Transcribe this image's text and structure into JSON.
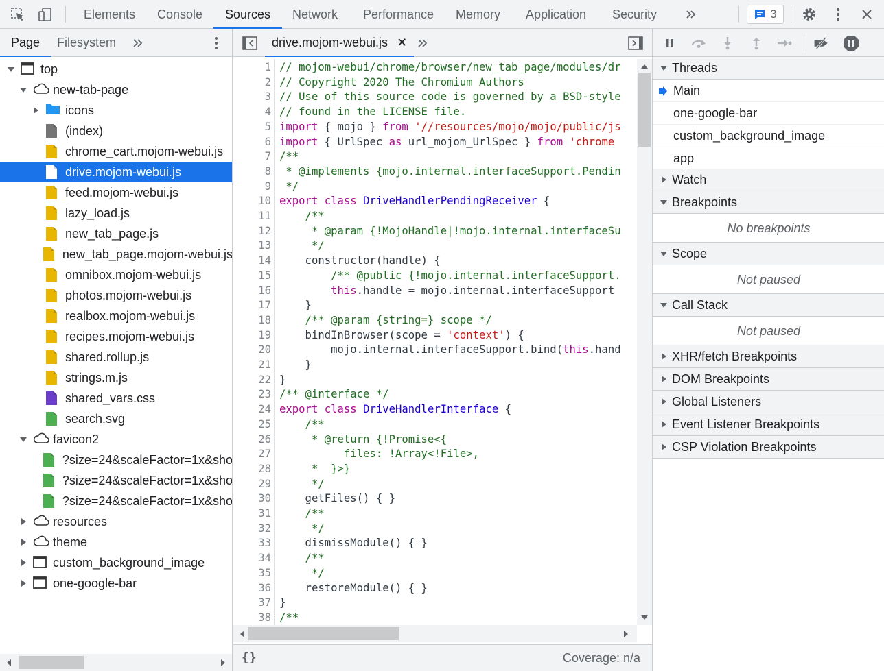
{
  "toolbar": {
    "tabs": [
      "Elements",
      "Console",
      "Sources",
      "Network",
      "Performance",
      "Memory",
      "Application",
      "Security"
    ],
    "active_tab": "Sources",
    "issues_count": "3",
    "icons": [
      "inspect-element-icon",
      "device-toolbar-icon",
      "more-tabs-icon",
      "issues-icon",
      "settings-gear-icon",
      "more-options-icon",
      "close-icon"
    ]
  },
  "navigator": {
    "tabs": [
      "Page",
      "Filesystem"
    ],
    "active_tab": "Page",
    "tree": [
      {
        "label": "top",
        "icon": "frame-icon",
        "expanded": true,
        "depth": 0
      },
      {
        "label": "new-tab-page",
        "icon": "cloud-icon",
        "expanded": true,
        "depth": 1
      },
      {
        "label": "icons",
        "icon": "folder-icon",
        "expanded": false,
        "depth": 2
      },
      {
        "label": "(index)",
        "icon": "document-icon",
        "depth": 2,
        "color": "#757575"
      },
      {
        "label": "chrome_cart.mojom-webui.js",
        "icon": "script-icon",
        "depth": 2,
        "color": "#e8b600"
      },
      {
        "label": "drive.mojom-webui.js",
        "icon": "script-icon",
        "depth": 2,
        "color": "#ffffff",
        "selected": true
      },
      {
        "label": "feed.mojom-webui.js",
        "icon": "script-icon",
        "depth": 2,
        "color": "#e8b600"
      },
      {
        "label": "lazy_load.js",
        "icon": "script-icon",
        "depth": 2,
        "color": "#e8b600"
      },
      {
        "label": "new_tab_page.js",
        "icon": "script-icon",
        "depth": 2,
        "color": "#e8b600"
      },
      {
        "label": "new_tab_page.mojom-webui.js",
        "icon": "script-icon",
        "depth": 2,
        "color": "#e8b600"
      },
      {
        "label": "omnibox.mojom-webui.js",
        "icon": "script-icon",
        "depth": 2,
        "color": "#e8b600"
      },
      {
        "label": "photos.mojom-webui.js",
        "icon": "script-icon",
        "depth": 2,
        "color": "#e8b600"
      },
      {
        "label": "realbox.mojom-webui.js",
        "icon": "script-icon",
        "depth": 2,
        "color": "#e8b600"
      },
      {
        "label": "recipes.mojom-webui.js",
        "icon": "script-icon",
        "depth": 2,
        "color": "#e8b600"
      },
      {
        "label": "shared.rollup.js",
        "icon": "script-icon",
        "depth": 2,
        "color": "#e8b600"
      },
      {
        "label": "strings.m.js",
        "icon": "script-icon",
        "depth": 2,
        "color": "#e8b600"
      },
      {
        "label": "shared_vars.css",
        "icon": "stylesheet-icon",
        "depth": 2,
        "color": "#6a3ec6"
      },
      {
        "label": "search.svg",
        "icon": "image-icon",
        "depth": 2,
        "color": "#4caf50"
      },
      {
        "label": "favicon2",
        "icon": "cloud-icon",
        "expanded": true,
        "depth": 1
      },
      {
        "label": "?size=24&scaleFactor=1x&sho",
        "icon": "image-icon",
        "depth": 2,
        "color": "#4caf50"
      },
      {
        "label": "?size=24&scaleFactor=1x&sho",
        "icon": "image-icon",
        "depth": 2,
        "color": "#4caf50"
      },
      {
        "label": "?size=24&scaleFactor=1x&sho",
        "icon": "image-icon",
        "depth": 2,
        "color": "#4caf50"
      },
      {
        "label": "resources",
        "icon": "cloud-icon",
        "expanded": false,
        "depth": 1
      },
      {
        "label": "theme",
        "icon": "cloud-icon",
        "expanded": false,
        "depth": 1
      },
      {
        "label": "custom_background_image",
        "icon": "frame-icon",
        "expanded": false,
        "depth": 1
      },
      {
        "label": "one-google-bar",
        "icon": "frame-icon",
        "expanded": false,
        "depth": 1
      }
    ]
  },
  "editor": {
    "file_tab": "drive.mojom-webui.js",
    "status": {
      "pretty_print": "{}",
      "coverage": "Coverage: n/a"
    },
    "lines": [
      [
        [
          "c",
          "// mojom-webui/chrome/browser/new_tab_page/modules/dr"
        ]
      ],
      [
        [
          "c",
          "// Copyright 2020 The Chromium Authors"
        ]
      ],
      [
        [
          "c",
          "// Use of this source code is governed by a BSD-style"
        ]
      ],
      [
        [
          "c",
          "// found in the LICENSE file."
        ]
      ],
      [
        [
          "k",
          "import"
        ],
        [
          "p",
          " { mojo } "
        ],
        [
          "k",
          "from"
        ],
        [
          "p",
          " "
        ],
        [
          "s",
          "'//resources/mojo/mojo/public/js"
        ]
      ],
      [
        [
          "k",
          "import"
        ],
        [
          "p",
          " { UrlSpec "
        ],
        [
          "k",
          "as"
        ],
        [
          "p",
          " url_mojom_UrlSpec } "
        ],
        [
          "k",
          "from"
        ],
        [
          "p",
          " "
        ],
        [
          "s",
          "'chrome"
        ]
      ],
      [
        [
          "c",
          "/**"
        ]
      ],
      [
        [
          "c",
          " * @implements {mojo.internal.interfaceSupport.Pendin"
        ]
      ],
      [
        [
          "c",
          " */"
        ]
      ],
      [
        [
          "k",
          "export class"
        ],
        [
          "p",
          " "
        ],
        [
          "t",
          "DriveHandlerPendingReceiver"
        ],
        [
          "p",
          " {"
        ]
      ],
      [
        [
          "c",
          "    /**"
        ]
      ],
      [
        [
          "c",
          "     * @param {!MojoHandle|!mojo.internal.interfaceSu"
        ]
      ],
      [
        [
          "c",
          "     */"
        ]
      ],
      [
        [
          "p",
          "    constructor(handle) {"
        ]
      ],
      [
        [
          "c",
          "        /** @public {!mojo.internal.interfaceSupport."
        ]
      ],
      [
        [
          "p",
          "        "
        ],
        [
          "k",
          "this"
        ],
        [
          "p",
          ".handle = mojo.internal.interfaceSupport"
        ]
      ],
      [
        [
          "p",
          "    }"
        ]
      ],
      [
        [
          "c",
          "    /** @param {string=} scope */"
        ]
      ],
      [
        [
          "p",
          "    bindInBrowser(scope = "
        ],
        [
          "s",
          "'context'"
        ],
        [
          "p",
          ") {"
        ]
      ],
      [
        [
          "p",
          "        mojo.internal.interfaceSupport.bind("
        ],
        [
          "k",
          "this"
        ],
        [
          "p",
          ".hand"
        ]
      ],
      [
        [
          "p",
          "    }"
        ]
      ],
      [
        [
          "p",
          "}"
        ]
      ],
      [
        [
          "c",
          "/** @interface */"
        ]
      ],
      [
        [
          "k",
          "export class"
        ],
        [
          "p",
          " "
        ],
        [
          "t",
          "DriveHandlerInterface"
        ],
        [
          "p",
          " {"
        ]
      ],
      [
        [
          "c",
          "    /**"
        ]
      ],
      [
        [
          "c",
          "     * @return {!Promise<{"
        ]
      ],
      [
        [
          "c",
          "          files: !Array<!File>,"
        ]
      ],
      [
        [
          "c",
          "     *  }>}"
        ]
      ],
      [
        [
          "c",
          "     */"
        ]
      ],
      [
        [
          "p",
          "    getFiles() { }"
        ]
      ],
      [
        [
          "c",
          "    /**"
        ]
      ],
      [
        [
          "c",
          "     */"
        ]
      ],
      [
        [
          "p",
          "    dismissModule() { }"
        ]
      ],
      [
        [
          "c",
          "    /**"
        ]
      ],
      [
        [
          "c",
          "     */"
        ]
      ],
      [
        [
          "p",
          "    restoreModule() { }"
        ]
      ],
      [
        [
          "p",
          "}"
        ]
      ],
      [
        [
          "c",
          "/**"
        ]
      ]
    ]
  },
  "debugger": {
    "toolbar_icons": [
      "pause-icon",
      "step-over-icon",
      "step-into-icon",
      "step-out-icon",
      "step-icon",
      "deactivate-breakpoints-icon",
      "pause-on-exceptions-icon"
    ],
    "threads_title": "Threads",
    "threads": [
      "Main",
      "one-google-bar",
      "custom_background_image",
      "app"
    ],
    "active_thread": "Main",
    "watch_title": "Watch",
    "breakpoints_title": "Breakpoints",
    "breakpoints_empty": "No breakpoints",
    "scope_title": "Scope",
    "scope_empty": "Not paused",
    "callstack_title": "Call Stack",
    "callstack_empty": "Not paused",
    "collapsed_sections": [
      "XHR/fetch Breakpoints",
      "DOM Breakpoints",
      "Global Listeners",
      "Event Listener Breakpoints",
      "CSP Violation Breakpoints"
    ]
  }
}
